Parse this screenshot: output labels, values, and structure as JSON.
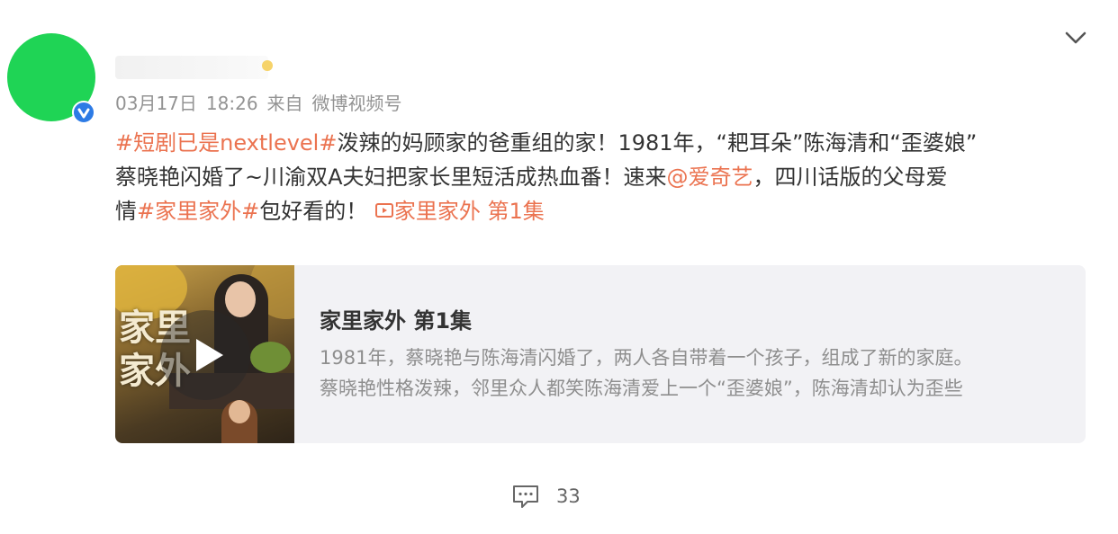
{
  "post": {
    "meta": {
      "date": "03月17日",
      "time": "18:26",
      "source_prefix": "来自",
      "source": "微博视频号"
    },
    "text": {
      "tag1": "#短剧已是nextlevel#",
      "line1_rest": "泼辣的妈顾家的爸重组的家！1981年，“耙耳朵”陈海清和“歪婆娘”",
      "line2_a": "蔡晓艳闪婚了~川渝双A夫妇把家长里短活成热血番！速来",
      "mention": "@爱奇艺",
      "line2_b": "，四川话版的父母爱",
      "line3_a": "情",
      "tag2": "#家里家外#",
      "line3_b": "包好看的！",
      "video_link": "家里家外 第1集"
    },
    "video_card": {
      "thumb_title_top": "家里",
      "thumb_title_bottom": "家外",
      "title": "家里家外 第1集",
      "desc_line1": "1981年，蔡晓艳与陈海清闪婚了，两人各自带着一个孩子，组成了新的家庭。",
      "desc_line2": "蔡晓艳性格泼辣，邻里众人都笑陈海清爱上一个“歪婆娘”，陈海清却认为歪些"
    },
    "footer": {
      "comment_count": "33"
    }
  },
  "colors": {
    "accent": "#eb7350",
    "avatar": "#1fd455",
    "verified": "#2d7be5",
    "meta_text": "#939393",
    "card_bg": "#f2f2f5"
  },
  "icons": {
    "verified": "verified-badge-icon",
    "expand": "chevron-down-icon",
    "video_link": "video-link-icon",
    "play": "play-icon",
    "comment": "comment-icon"
  }
}
